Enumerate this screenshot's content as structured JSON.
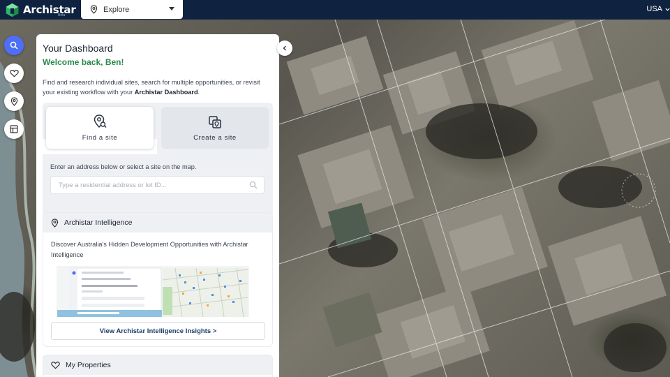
{
  "app": {
    "brand": "Archistar",
    "brand_sub": "Beta",
    "brand_color": "#0f2340",
    "accent_color": "#4f6ef7",
    "success_color": "#2b8a4e"
  },
  "topbar": {
    "explore_label": "Explore",
    "country_label": "USA"
  },
  "rail": {
    "items": [
      {
        "icon": "search-icon",
        "active": true
      },
      {
        "icon": "heart-icon",
        "active": false
      },
      {
        "icon": "intelligence-icon",
        "active": false
      },
      {
        "icon": "layout-icon",
        "active": false
      }
    ]
  },
  "dashboard": {
    "title": "Your Dashboard",
    "welcome": "Welcome back, Ben!",
    "intro_text": "Find and research individual sites, search for multiple opportunities, or revisit your existing workflow with your ",
    "intro_bold": "Archistar Dashboard",
    "intro_end": ".",
    "tabs": [
      {
        "label": "Find a site",
        "icon": "find-site-icon",
        "selected": true
      },
      {
        "label": "Create a site",
        "icon": "create-site-icon",
        "selected": false
      }
    ],
    "search_hint": "Enter an address below or select a site on the map.",
    "search_placeholder": "Type a residential address or lot ID...",
    "search_value": ""
  },
  "intelligence": {
    "title": "Archistar Intelligence",
    "description": "Discover Australia's Hidden Development Opportunities with Archistar Intelligence",
    "button_label": "View Archistar Intelligence Insights >"
  },
  "properties": {
    "title": "My Properties"
  }
}
